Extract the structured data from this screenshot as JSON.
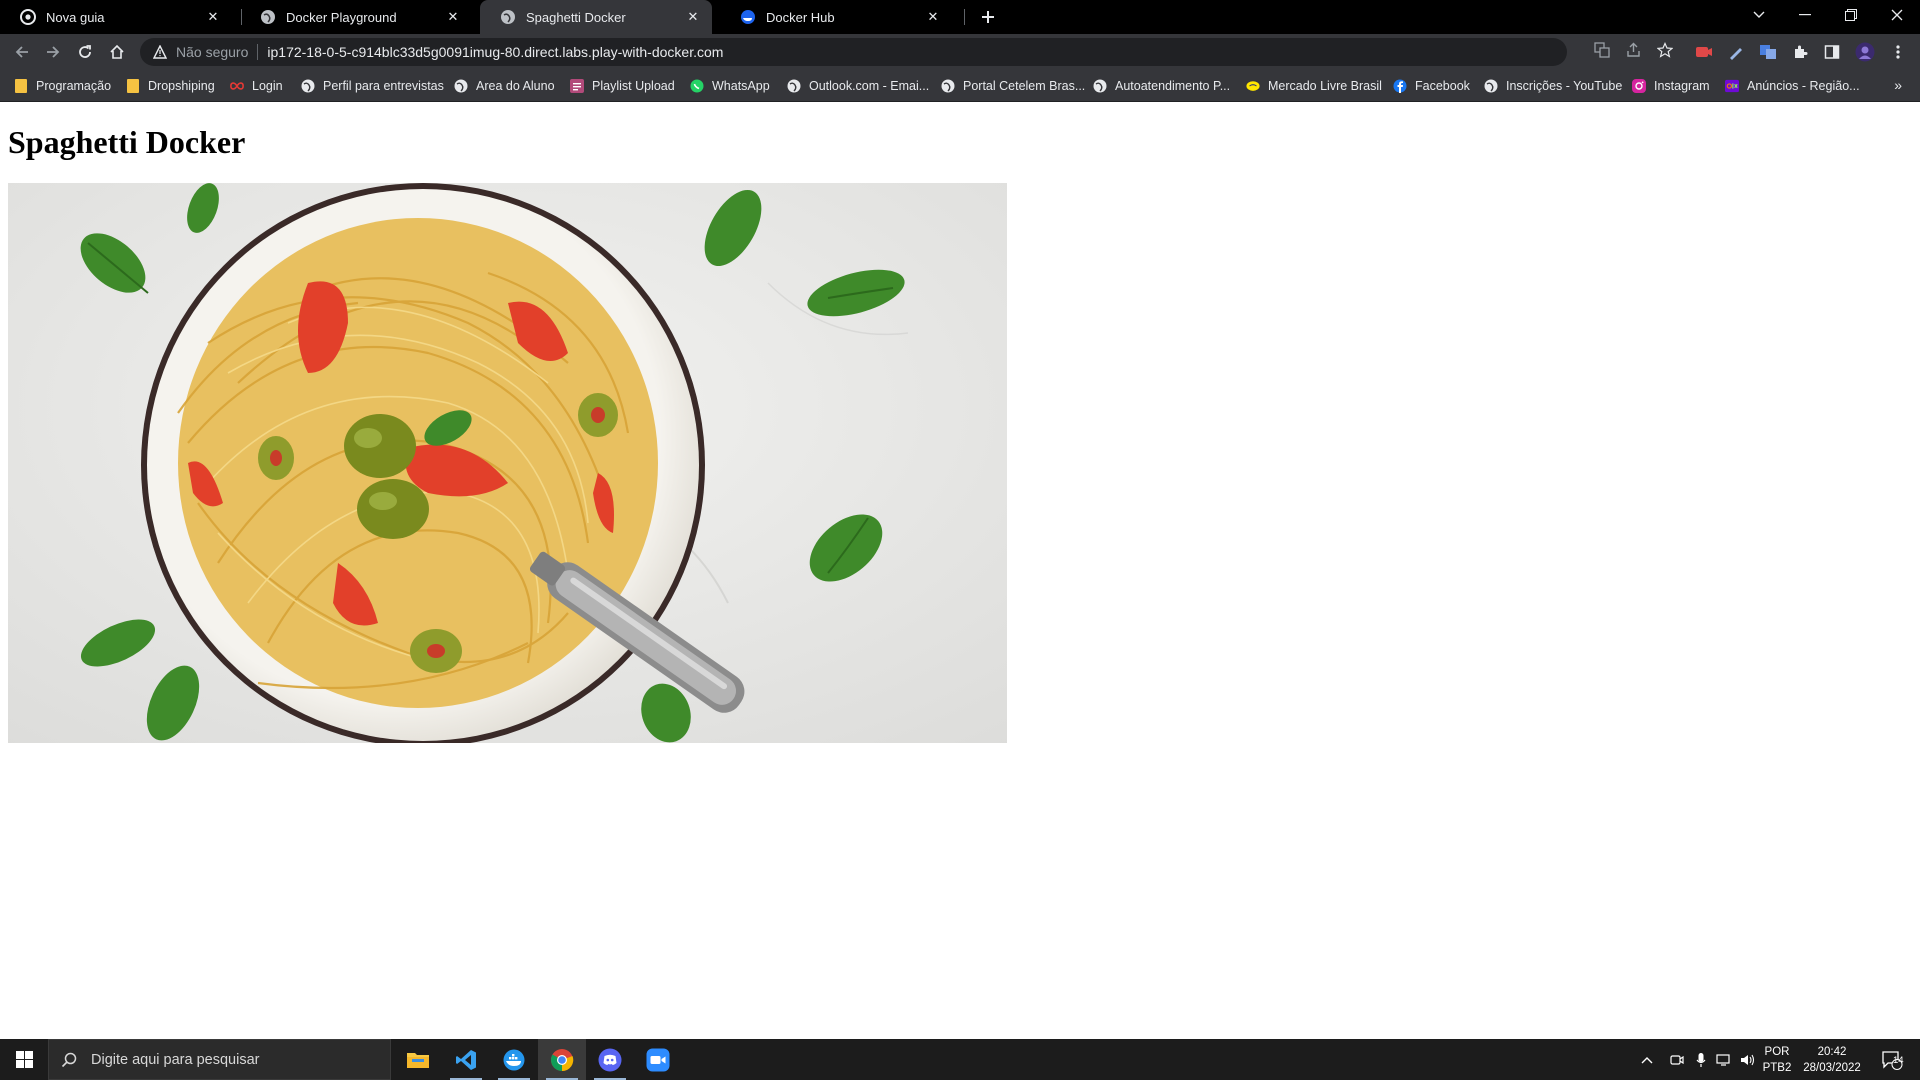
{
  "browser": {
    "tabs": [
      {
        "title": "Nova guia",
        "icon": "chrome-icon",
        "active": false
      },
      {
        "title": "Docker Playground",
        "icon": "globe-icon",
        "active": false
      },
      {
        "title": "Spaghetti Docker",
        "icon": "globe-icon",
        "active": true
      },
      {
        "title": "Docker Hub",
        "icon": "docker-hub-icon",
        "active": false
      }
    ],
    "new_tab_label": "+",
    "security_label": "Não seguro",
    "url": "ip172-18-0-5-c914blc33d5g0091imug-80.direct.labs.play-with-docker.com",
    "bookmarks": [
      {
        "label": "Programação",
        "icon": "folder-icon"
      },
      {
        "label": "Dropshiping",
        "icon": "folder-icon"
      },
      {
        "label": "Login",
        "icon": "infinity-icon"
      },
      {
        "label": "Perfil para entrevistas",
        "icon": "globe-icon"
      },
      {
        "label": "Area do Aluno",
        "icon": "globe-icon"
      },
      {
        "label": "Playlist Upload",
        "icon": "playlist-icon"
      },
      {
        "label": "WhatsApp",
        "icon": "whatsapp-icon"
      },
      {
        "label": "Outlook.com - Emai...",
        "icon": "globe-icon"
      },
      {
        "label": "Portal Cetelem Bras...",
        "icon": "globe-icon"
      },
      {
        "label": "Autoatendimento P...",
        "icon": "globe-icon"
      },
      {
        "label": "Mercado Livre Brasil",
        "icon": "mercado-livre-icon"
      },
      {
        "label": "Facebook",
        "icon": "facebook-icon"
      },
      {
        "label": "Inscrições - YouTube",
        "icon": "globe-icon"
      },
      {
        "label": "Instagram",
        "icon": "instagram-icon"
      },
      {
        "label": "Anúncios - Região...",
        "icon": "olx-icon"
      }
    ],
    "more_bookmarks": "»"
  },
  "page": {
    "heading": "Spaghetti Docker",
    "image": "plate of spaghetti with tomatoes, olives and basil"
  },
  "taskbar": {
    "search_placeholder": "Digite aqui para pesquisar",
    "apps": [
      "file-explorer-icon",
      "vscode-icon",
      "docker-icon",
      "chrome-icon",
      "discord-icon",
      "zoom-icon"
    ],
    "language": "POR",
    "keyboard": "PTB2",
    "time": "20:42",
    "date": "28/03/2022",
    "notifications": "14"
  },
  "colors": {
    "tab_strip": "#000000",
    "toolbar": "#35363a",
    "omnibox": "#202124",
    "taskbar": "#1c1c1c"
  }
}
